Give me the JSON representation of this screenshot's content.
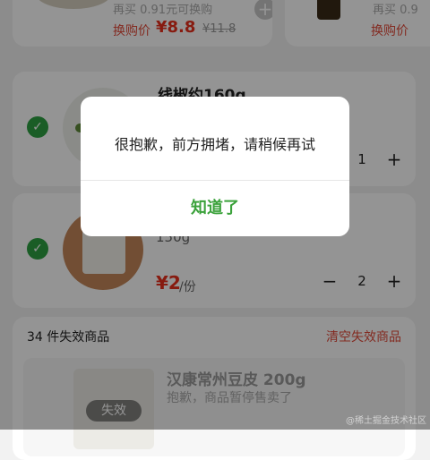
{
  "top_row": {
    "left": {
      "partial_text": "再买 0.91元可换购",
      "swap_label": "换购价",
      "price": "¥8.8",
      "original_price": "¥11.8",
      "add_icon": "plus-circle-icon"
    },
    "right": {
      "partial_text": "再买 0.9",
      "swap_label": "换购价"
    }
  },
  "cart_items": [
    {
      "title": "线椒约160g",
      "quantity": "1",
      "checked_icon": "checkmark-icon"
    },
    {
      "title_partial": "150g",
      "price": "¥2",
      "unit": "/份",
      "quantity": "2",
      "checked_icon": "checkmark-icon"
    }
  ],
  "stepper": {
    "minus": "−",
    "plus": "+"
  },
  "invalid_section": {
    "count_label": "34 件失效商品",
    "clear_label": "清空失效商品",
    "item": {
      "title": "汉康常州豆皮 200g",
      "subtitle": "抱歉，商品暂停售卖了",
      "badge": "失效"
    }
  },
  "dialog": {
    "message": "很抱歉，前方拥堵，请稍候再试",
    "confirm_label": "知道了"
  },
  "watermark": "@稀土掘金技术社区",
  "colors": {
    "accent_green": "#3ba23b",
    "check_green": "#2ea043",
    "price_red": "#e8301c",
    "mask": "rgba(0,0,0,0.42)"
  }
}
